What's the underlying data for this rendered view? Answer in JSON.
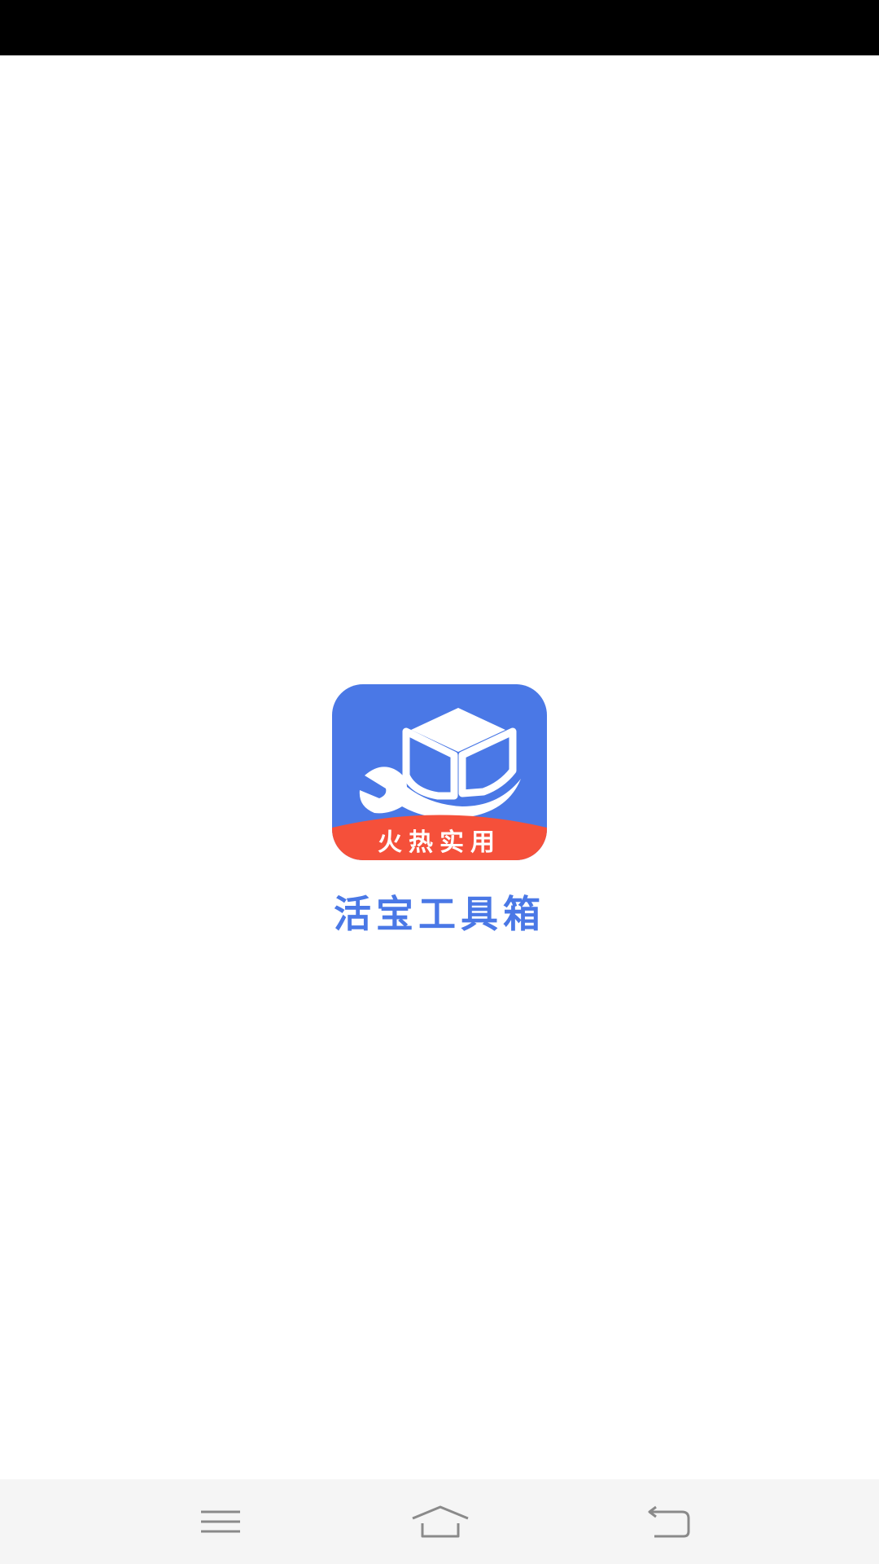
{
  "app": {
    "name": "活宝工具箱",
    "badge": "火热实用"
  },
  "colors": {
    "brand_blue": "#4a78e6",
    "badge_red": "#f5503a",
    "status_bar": "#000000",
    "nav_bar": "#f5f5f5",
    "nav_icon": "#8a8a8a"
  },
  "navigation": {
    "menu_icon": "menu-icon",
    "home_icon": "home-icon",
    "back_icon": "back-icon"
  }
}
